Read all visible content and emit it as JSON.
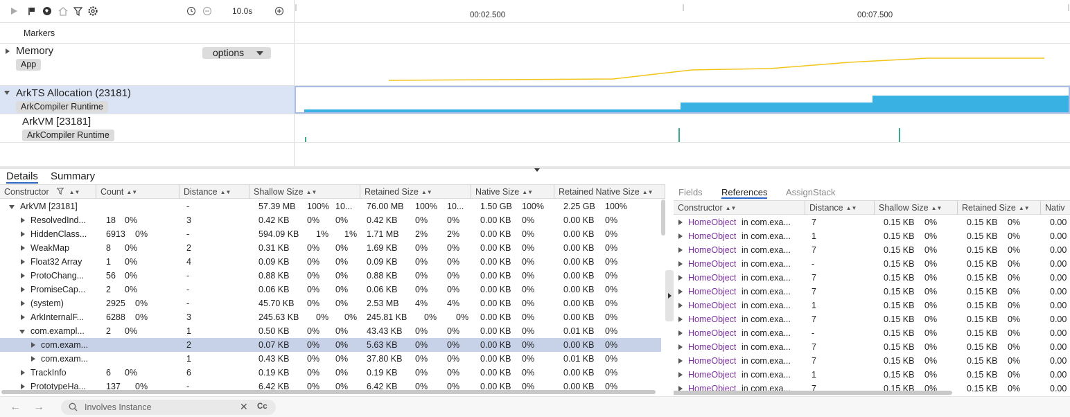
{
  "toolbar": {
    "icons": [
      "play-icon",
      "flag-icon",
      "globe-icon",
      "home-icon",
      "filter-icon",
      "gear-icon",
      "reset-icon",
      "zoom-out-icon",
      "zoom-in-icon"
    ],
    "duration": "10.0s"
  },
  "timeline": {
    "ticks": [
      "00:02.500",
      "00:07.500"
    ]
  },
  "tracks": {
    "markers": "Markers",
    "memory": {
      "title": "Memory",
      "chip": "App",
      "options": "options"
    },
    "arkts": {
      "title": "ArkTS Allocation (23181)",
      "chip": "ArkCompiler Runtime"
    },
    "arkvm": {
      "title": "ArkVM [23181]",
      "chip": "ArkCompiler Runtime"
    }
  },
  "colors": {
    "memory_line": "#f2c417",
    "allocation_fill": "#3ab1e3",
    "vm_marks": "#3aaa8e",
    "selection": "#c7d2e8",
    "active_tab": "#2966c8",
    "link": "#7a2f9f"
  },
  "bottom_tabs": [
    "Details",
    "Summary"
  ],
  "left_table": {
    "columns": [
      "Constructor",
      "Count",
      "Distance",
      "Shallow Size",
      "Retained Size",
      "Native Size",
      "Retained Native Size"
    ],
    "rows": [
      {
        "name": "ArkVM [23181]",
        "expanded": true,
        "level": 0,
        "count": "",
        "dist": "-",
        "shallow": "57.39 MB",
        "sp": "100%",
        "sp2": "10...",
        "retained": "76.00 MB",
        "rp": "100%",
        "rp2": "10...",
        "native": "1.50 GB",
        "np": "100%",
        "rnative": "2.25 GB",
        "rnp": "100%"
      },
      {
        "name": "ResolvedInd...",
        "expanded": false,
        "level": 1,
        "count": "18",
        "cp": "0%",
        "dist": "3",
        "shallow": "0.42 KB",
        "sp": "0%",
        "sp2": "0%",
        "retained": "0.42 KB",
        "rp": "0%",
        "rp2": "0%",
        "native": "0.00 KB",
        "np": "0%",
        "rnative": "0.00 KB",
        "rnp": "0%"
      },
      {
        "name": "HiddenClass...",
        "expanded": false,
        "level": 1,
        "count": "6913",
        "cp": "0%",
        "dist": "-",
        "shallow": "594.09 KB",
        "sp": "1%",
        "sp2": "1%",
        "retained": "1.71 MB",
        "rp": "2%",
        "rp2": "2%",
        "native": "0.00 KB",
        "np": "0%",
        "rnative": "0.00 KB",
        "rnp": "0%"
      },
      {
        "name": "WeakMap",
        "expanded": false,
        "level": 1,
        "count": "8",
        "cp": "0%",
        "dist": "2",
        "shallow": "0.31 KB",
        "sp": "0%",
        "sp2": "0%",
        "retained": "1.69 KB",
        "rp": "0%",
        "rp2": "0%",
        "native": "0.00 KB",
        "np": "0%",
        "rnative": "0.00 KB",
        "rnp": "0%"
      },
      {
        "name": "Float32 Array",
        "expanded": false,
        "level": 1,
        "count": "1",
        "cp": "0%",
        "dist": "4",
        "shallow": "0.09 KB",
        "sp": "0%",
        "sp2": "0%",
        "retained": "0.09 KB",
        "rp": "0%",
        "rp2": "0%",
        "native": "0.00 KB",
        "np": "0%",
        "rnative": "0.00 KB",
        "rnp": "0%"
      },
      {
        "name": "ProtoChang...",
        "expanded": false,
        "level": 1,
        "count": "56",
        "cp": "0%",
        "dist": "-",
        "shallow": "0.88 KB",
        "sp": "0%",
        "sp2": "0%",
        "retained": "0.88 KB",
        "rp": "0%",
        "rp2": "0%",
        "native": "0.00 KB",
        "np": "0%",
        "rnative": "0.00 KB",
        "rnp": "0%"
      },
      {
        "name": "PromiseCap...",
        "expanded": false,
        "level": 1,
        "count": "2",
        "cp": "0%",
        "dist": "-",
        "shallow": "0.06 KB",
        "sp": "0%",
        "sp2": "0%",
        "retained": "0.06 KB",
        "rp": "0%",
        "rp2": "0%",
        "native": "0.00 KB",
        "np": "0%",
        "rnative": "0.00 KB",
        "rnp": "0%"
      },
      {
        "name": "(system)",
        "expanded": false,
        "level": 1,
        "count": "2925",
        "cp": "0%",
        "dist": "-",
        "shallow": "45.70 KB",
        "sp": "0%",
        "sp2": "0%",
        "retained": "2.53 MB",
        "rp": "4%",
        "rp2": "4%",
        "native": "0.00 KB",
        "np": "0%",
        "rnative": "0.00 KB",
        "rnp": "0%"
      },
      {
        "name": "ArkInternalF...",
        "expanded": false,
        "level": 1,
        "count": "6288",
        "cp": "0%",
        "dist": "3",
        "shallow": "245.63 KB",
        "sp": "0%",
        "sp2": "0%",
        "retained": "245.81 KB",
        "rp": "0%",
        "rp2": "0%",
        "native": "0.00 KB",
        "np": "0%",
        "rnative": "0.00 KB",
        "rnp": "0%"
      },
      {
        "name": "com.exampl...",
        "expanded": true,
        "level": 1,
        "count": "2",
        "cp": "0%",
        "dist": "1",
        "shallow": "0.50 KB",
        "sp": "0%",
        "sp2": "0%",
        "retained": "43.43 KB",
        "rp": "0%",
        "rp2": "0%",
        "native": "0.00 KB",
        "np": "0%",
        "rnative": "0.01 KB",
        "rnp": "0%"
      },
      {
        "name": "com.exam...",
        "expanded": false,
        "level": 2,
        "selected": true,
        "count": "",
        "dist": "2",
        "shallow": "0.07 KB",
        "sp": "0%",
        "sp2": "0%",
        "retained": "5.63 KB",
        "rp": "0%",
        "rp2": "0%",
        "native": "0.00 KB",
        "np": "0%",
        "rnative": "0.00 KB",
        "rnp": "0%"
      },
      {
        "name": "com.exam...",
        "expanded": false,
        "level": 2,
        "count": "",
        "dist": "1",
        "shallow": "0.43 KB",
        "sp": "0%",
        "sp2": "0%",
        "retained": "37.80 KB",
        "rp": "0%",
        "rp2": "0%",
        "native": "0.00 KB",
        "np": "0%",
        "rnative": "0.01 KB",
        "rnp": "0%"
      },
      {
        "name": "TrackInfo",
        "expanded": false,
        "level": 1,
        "count": "6",
        "cp": "0%",
        "dist": "6",
        "shallow": "0.19 KB",
        "sp": "0%",
        "sp2": "0%",
        "retained": "0.19 KB",
        "rp": "0%",
        "rp2": "0%",
        "native": "0.00 KB",
        "np": "0%",
        "rnative": "0.00 KB",
        "rnp": "0%"
      },
      {
        "name": "PrototypeHa...",
        "expanded": false,
        "level": 1,
        "count": "137",
        "cp": "0%",
        "dist": "-",
        "shallow": "6.42 KB",
        "sp": "0%",
        "sp2": "0%",
        "retained": "6.42 KB",
        "rp": "0%",
        "rp2": "0%",
        "native": "0.00 KB",
        "np": "0%",
        "rnative": "0.00 KB",
        "rnp": "0%"
      }
    ]
  },
  "right_tabs": [
    "Fields",
    "References",
    "AssignStack"
  ],
  "right_table": {
    "columns": [
      "Constructor",
      "Distance",
      "Shallow Size",
      "Retained Size",
      "Nativ"
    ],
    "link_text": "HomeObject",
    "suffix": " in com.exa...",
    "rows": [
      {
        "dist": "7",
        "shallow": "0.15 KB",
        "sp": "0%",
        "retained": "0.15 KB",
        "rp": "0%",
        "native": "0.00"
      },
      {
        "dist": "1",
        "shallow": "0.15 KB",
        "sp": "0%",
        "retained": "0.15 KB",
        "rp": "0%",
        "native": "0.00"
      },
      {
        "dist": "7",
        "shallow": "0.15 KB",
        "sp": "0%",
        "retained": "0.15 KB",
        "rp": "0%",
        "native": "0.00"
      },
      {
        "dist": "-",
        "shallow": "0.15 KB",
        "sp": "0%",
        "retained": "0.15 KB",
        "rp": "0%",
        "native": "0.00"
      },
      {
        "dist": "7",
        "shallow": "0.15 KB",
        "sp": "0%",
        "retained": "0.15 KB",
        "rp": "0%",
        "native": "0.00"
      },
      {
        "dist": "7",
        "shallow": "0.15 KB",
        "sp": "0%",
        "retained": "0.15 KB",
        "rp": "0%",
        "native": "0.00"
      },
      {
        "dist": "1",
        "shallow": "0.15 KB",
        "sp": "0%",
        "retained": "0.15 KB",
        "rp": "0%",
        "native": "0.00"
      },
      {
        "dist": "7",
        "shallow": "0.15 KB",
        "sp": "0%",
        "retained": "0.15 KB",
        "rp": "0%",
        "native": "0.00"
      },
      {
        "dist": "-",
        "shallow": "0.15 KB",
        "sp": "0%",
        "retained": "0.15 KB",
        "rp": "0%",
        "native": "0.00"
      },
      {
        "dist": "7",
        "shallow": "0.15 KB",
        "sp": "0%",
        "retained": "0.15 KB",
        "rp": "0%",
        "native": "0.00"
      },
      {
        "dist": "7",
        "shallow": "0.15 KB",
        "sp": "0%",
        "retained": "0.15 KB",
        "rp": "0%",
        "native": "0.00"
      },
      {
        "dist": "1",
        "shallow": "0.15 KB",
        "sp": "0%",
        "retained": "0.15 KB",
        "rp": "0%",
        "native": "0.00"
      },
      {
        "dist": "7",
        "shallow": "0.15 KB",
        "sp": "0%",
        "retained": "0.15 KB",
        "rp": "0%",
        "native": "0.00"
      }
    ]
  },
  "search": {
    "placeholder": "Involves Instance",
    "clear": "✕",
    "case": "Cc"
  }
}
